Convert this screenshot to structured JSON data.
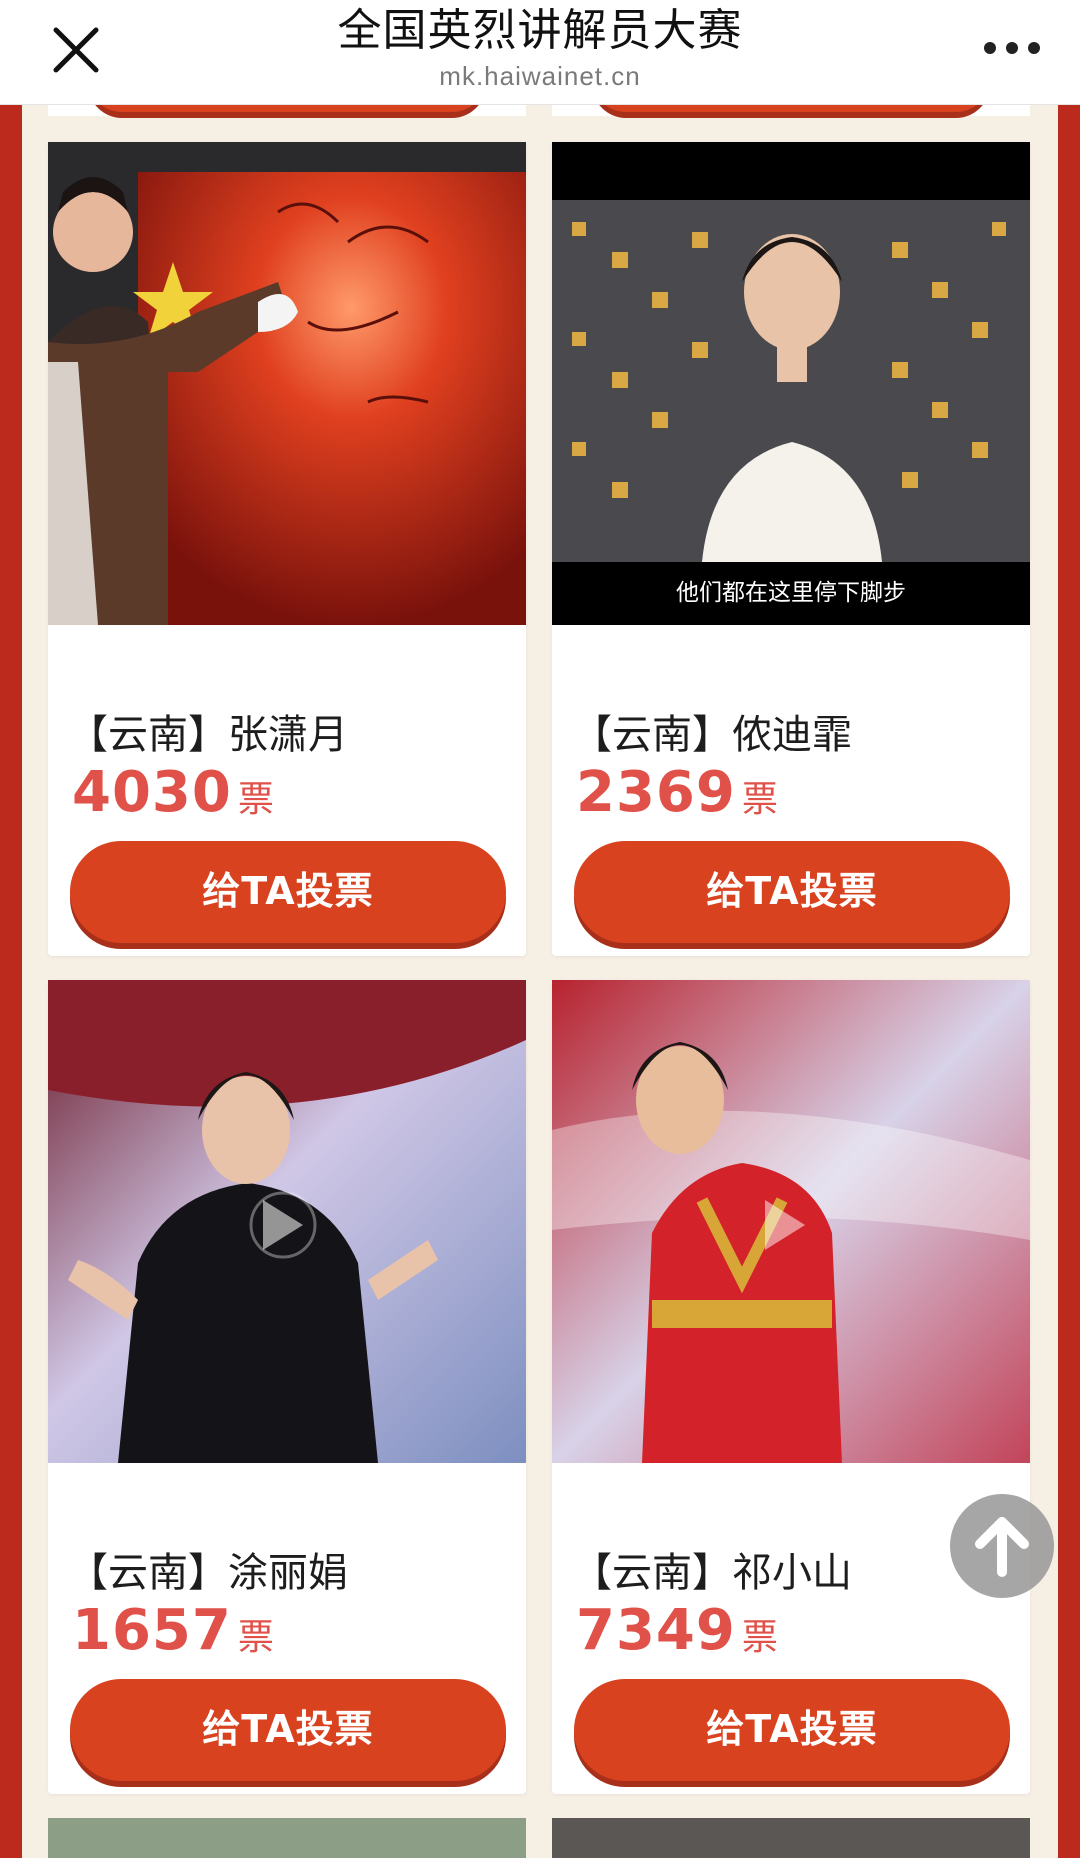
{
  "header": {
    "title": "全国英烈讲解员大赛",
    "domain": "mk.haiwainet.cn"
  },
  "icons": {
    "close": "close-icon",
    "more": "more-dots-icon",
    "scroll_top": "arrow-up-icon"
  },
  "colors": {
    "frame_red": "#bb2a1d",
    "button_red": "#d9421f",
    "vote_number": "#e0514a",
    "page_bg": "#f6efe4"
  },
  "cards": [
    {
      "name": "【云南】张潇月",
      "votes": "4030",
      "unit": "票",
      "button": "给TA投票"
    },
    {
      "name": "【云南】侬迪霏",
      "votes": "2369",
      "unit": "票",
      "button": "给TA投票",
      "caption": "他们都在这里停下脚步"
    },
    {
      "name": "【云南】涂丽娟",
      "votes": "1657",
      "unit": "票",
      "button": "给TA投票"
    },
    {
      "name": "【云南】祁小山",
      "votes": "7349",
      "unit": "票",
      "button": "给TA投票"
    }
  ]
}
